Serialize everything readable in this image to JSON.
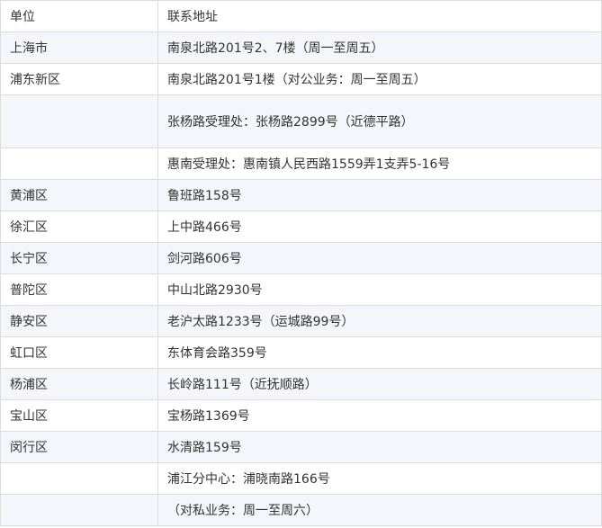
{
  "table": {
    "header": {
      "unit": "单位",
      "address": "联系地址"
    },
    "rows": [
      {
        "unit": "上海市",
        "address": "南泉北路201号2、7楼（周一至周五）"
      },
      {
        "unit": "浦东新区",
        "address": "南泉北路201号1楼（对公业务：周一至周五）"
      },
      {
        "unit": "",
        "address": "张杨路受理处：张杨路2899号（近德平路）"
      },
      {
        "unit": "",
        "address": "惠南受理处：惠南镇人民西路1559弄1支弄5-16号"
      },
      {
        "unit": "黄浦区",
        "address": "鲁班路158号"
      },
      {
        "unit": "徐汇区",
        "address": "上中路466号"
      },
      {
        "unit": "长宁区",
        "address": "剑河路606号"
      },
      {
        "unit": "普陀区",
        "address": "中山北路2930号"
      },
      {
        "unit": "静安区",
        "address": "老沪太路1233号（运城路99号）"
      },
      {
        "unit": "虹口区",
        "address": "东体育会路359号"
      },
      {
        "unit": "杨浦区",
        "address": "长岭路111号（近抚顺路）"
      },
      {
        "unit": "宝山区",
        "address": "宝杨路1369号"
      },
      {
        "unit": "闵行区",
        "address": "水清路159号"
      },
      {
        "unit": "",
        "address": "浦江分中心：浦晓南路166号"
      },
      {
        "unit": "",
        "address": "（对私业务：周一至周六）"
      }
    ]
  }
}
